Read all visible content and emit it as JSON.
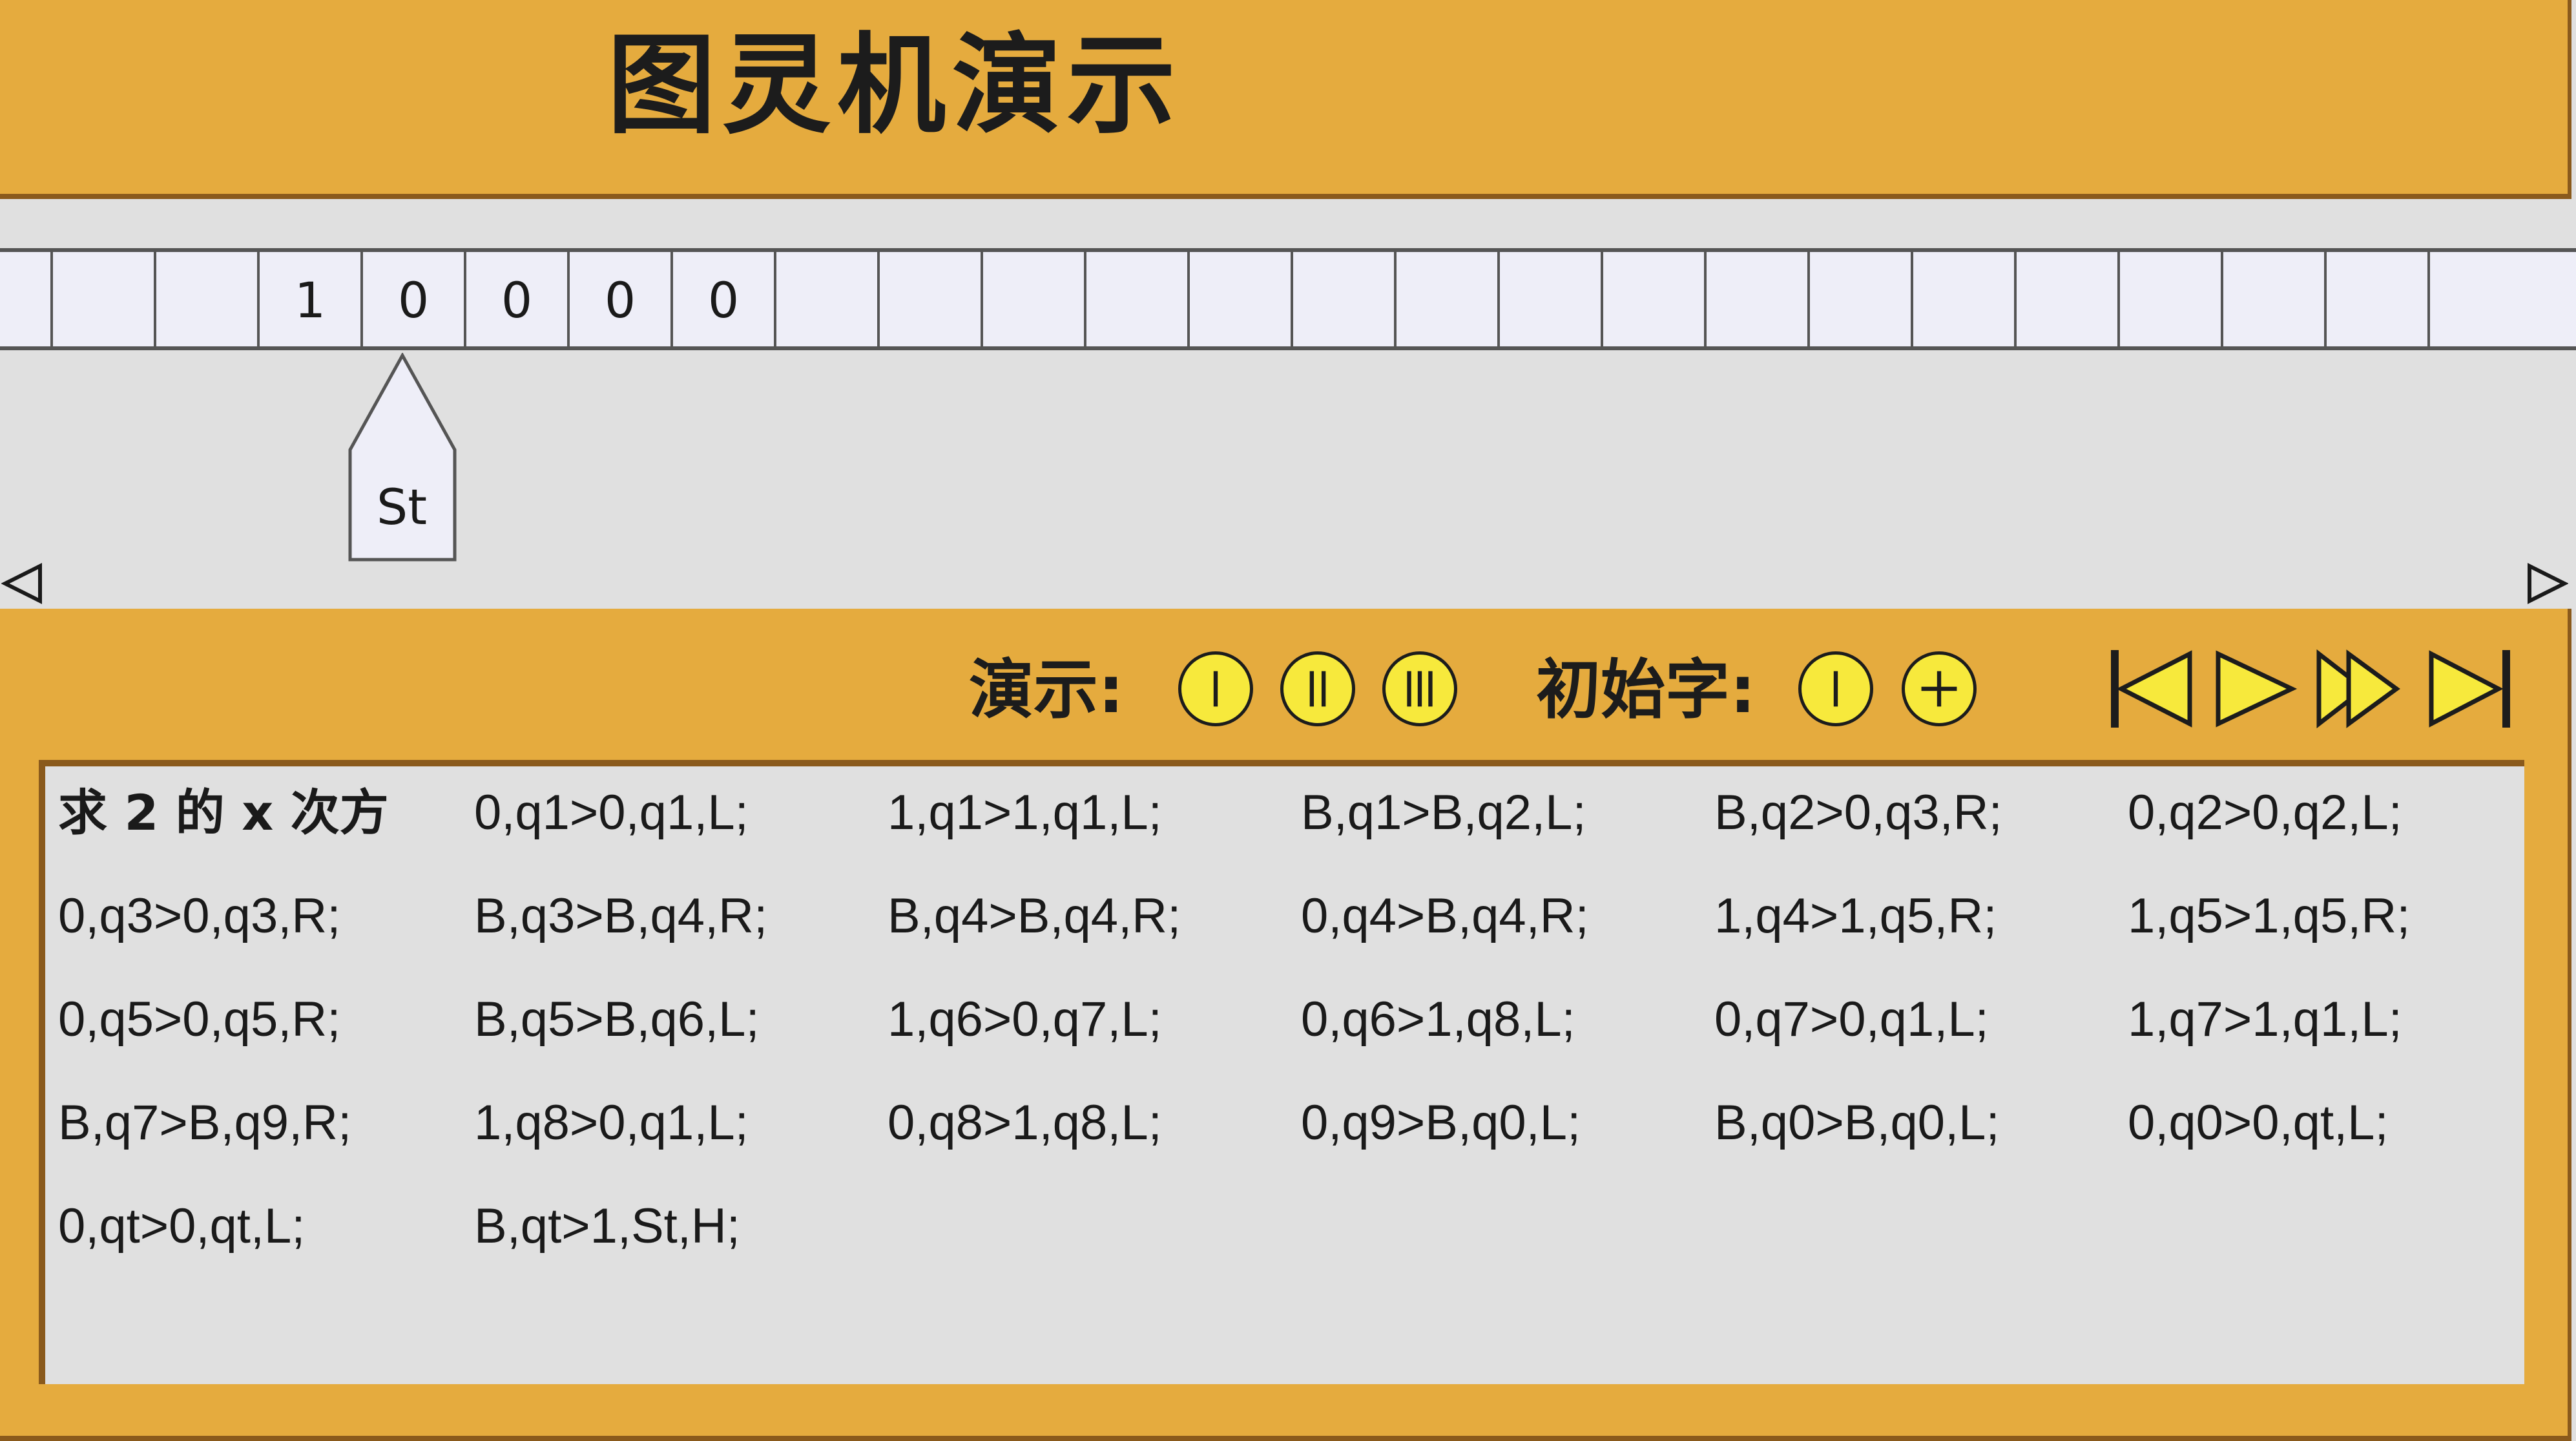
{
  "app": {
    "title": "图灵机演示"
  },
  "tape": {
    "cells": [
      "",
      "",
      "",
      "1",
      "0",
      "0",
      "0",
      "0",
      "",
      "",
      "",
      "",
      "",
      "",
      "",
      "",
      "",
      "",
      "",
      "",
      "",
      "",
      "",
      "",
      ""
    ],
    "head_state": "St"
  },
  "controls": {
    "demo_label": "演示:",
    "demo_buttons": [
      "I",
      "II",
      "III"
    ],
    "initial_label": "初始字:",
    "initial_buttons": [
      "I",
      "+"
    ],
    "nav_buttons": [
      "first",
      "play",
      "fast-forward",
      "last"
    ]
  },
  "rules": {
    "title": "求 2 的 x 次方",
    "items": [
      "0,q1>0,q1,L;",
      "1,q1>1,q1,L;",
      "B,q1>B,q2,L;",
      "B,q2>0,q3,R;",
      "0,q2>0,q2,L;",
      "0,q3>0,q3,R;",
      "B,q3>B,q4,R;",
      "B,q4>B,q4,R;",
      "0,q4>B,q4,R;",
      "1,q4>1,q5,R;",
      "1,q5>1,q5,R;",
      "0,q5>0,q5,R;",
      "B,q5>B,q6,L;",
      "1,q6>0,q7,L;",
      "0,q6>1,q8,L;",
      "0,q7>0,q1,L;",
      "1,q7>1,q1,L;",
      "B,q7>B,q9,R;",
      "1,q8>0,q1,L;",
      "0,q8>1,q8,L;",
      "0,q9>B,q0,L;",
      "B,q0>B,q0,L;",
      "0,q0>0,qt,L;",
      "0,qt>0,qt,L;",
      "B,qt>1,St,H;"
    ]
  },
  "colors": {
    "panel": "#e5ab3e",
    "border": "#8a5a1c",
    "tape_cell": "#eeeef8",
    "button_fill": "#f7e93c",
    "background": "#e0e0e0"
  }
}
